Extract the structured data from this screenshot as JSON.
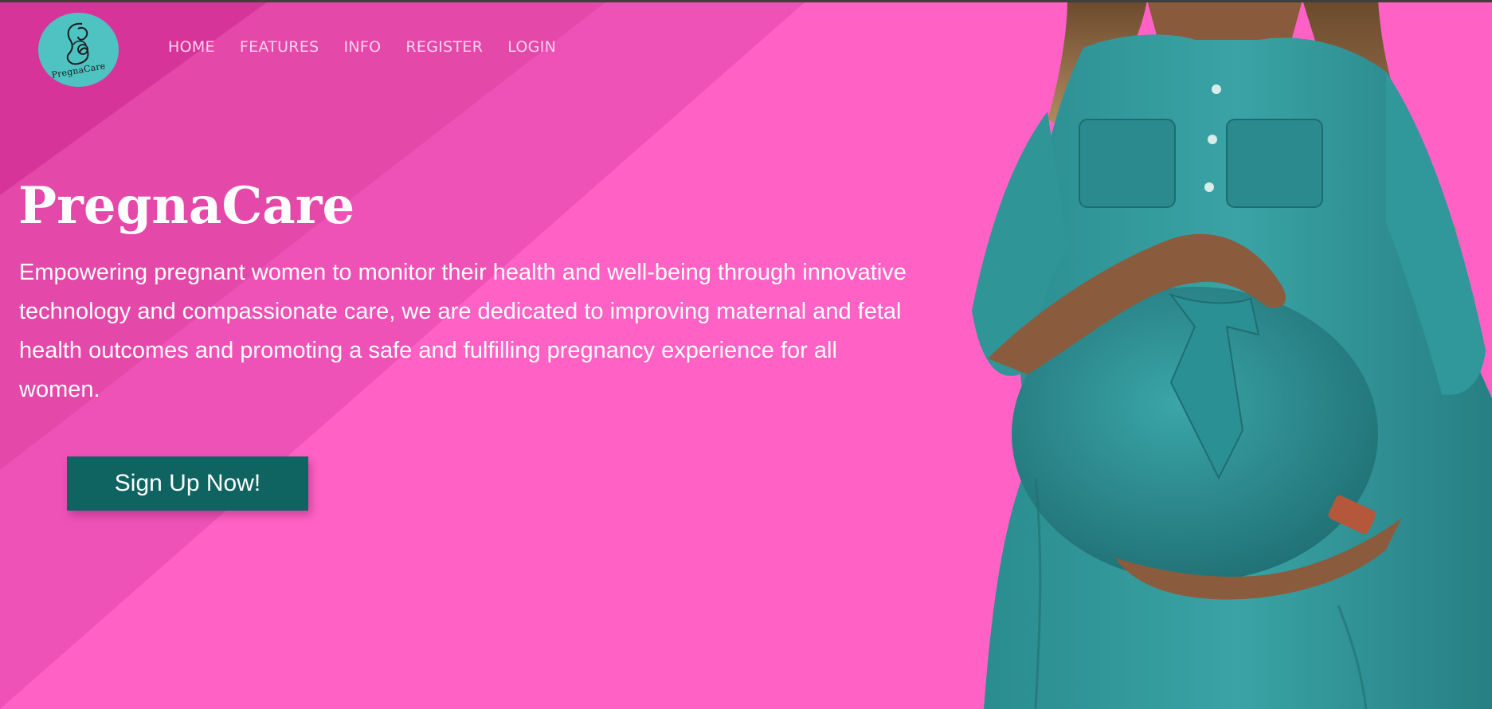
{
  "brand": {
    "logo_text": "PregnaCare",
    "logo_color": "#4ec3c2"
  },
  "nav": {
    "items": [
      {
        "label": "HOME"
      },
      {
        "label": "FEATURES"
      },
      {
        "label": "INFO"
      },
      {
        "label": "REGISTER"
      },
      {
        "label": "LOGIN"
      }
    ]
  },
  "hero": {
    "title": "PregnaCare",
    "description": "Empowering pregnant women to monitor their health and well-being through innovative technology and compassionate care, we are dedicated to improving maternal and fetal health outcomes and promoting a safe and fulfilling pregnancy experience for all women.",
    "cta_label": "Sign Up Now!"
  },
  "colors": {
    "background": "#ff62c4",
    "stripe_dark": "#cf2a8f",
    "stripe_mid": "#e03fa3",
    "stripe_light": "#ee52b6",
    "button": "#0f6462",
    "nav_text": "#ffd2ee",
    "dress": "#2a8f92"
  },
  "images": {
    "hero_image": "pregnant-woman-teal-dress"
  }
}
